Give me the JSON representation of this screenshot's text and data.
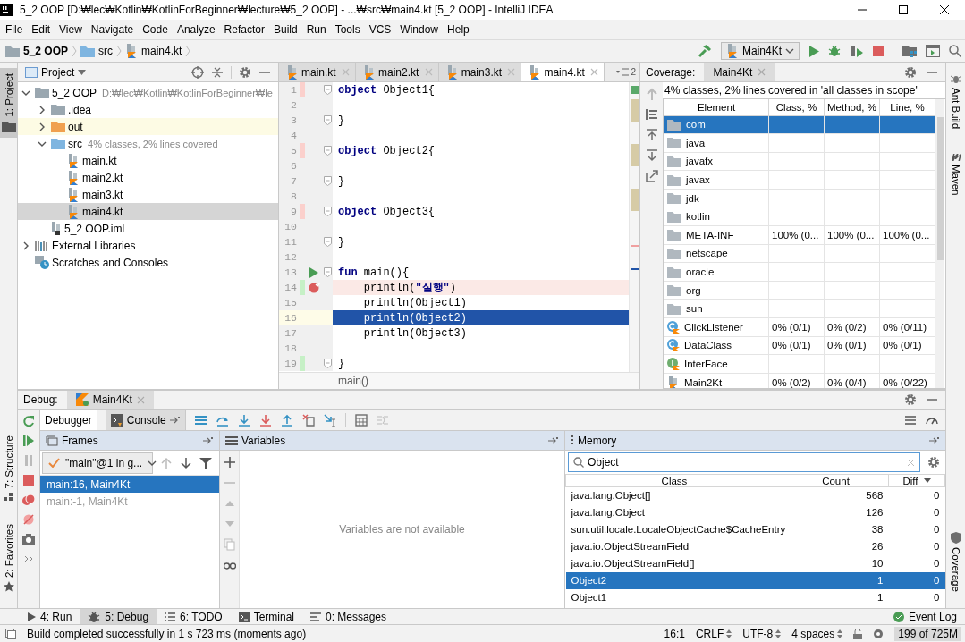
{
  "window": {
    "title": "5_2 OOP [D:₩lec₩Kotlin₩KotlinForBeginner₩lecture₩5_2 OOP] - ...₩src₩main4.kt [5_2 OOP] - IntelliJ IDEA"
  },
  "menu": [
    "File",
    "Edit",
    "View",
    "Navigate",
    "Code",
    "Analyze",
    "Refactor",
    "Build",
    "Run",
    "Tools",
    "VCS",
    "Window",
    "Help"
  ],
  "breadcrumbs": [
    {
      "label": "5_2 OOP",
      "kind": "project"
    },
    {
      "label": "src",
      "kind": "folder"
    },
    {
      "label": "main4.kt",
      "kind": "kotlin"
    }
  ],
  "run_config": {
    "label": "Main4Kt"
  },
  "left_stripe": {
    "top": [
      {
        "label": "1: Project",
        "selected": true
      }
    ],
    "bottom": [
      {
        "label": "7: Structure",
        "selected": false
      },
      {
        "label": "2: Favorites",
        "selected": false
      }
    ]
  },
  "right_stripe": {
    "top": [
      {
        "label": "Ant Build",
        "kind": "ant"
      },
      {
        "label": "Maven",
        "kind": "maven"
      }
    ],
    "bottom": [
      {
        "label": "Coverage",
        "kind": "coverage"
      }
    ]
  },
  "project": {
    "title": "Project",
    "tree": [
      {
        "label": "5_2 OOP",
        "hint": "D:₩lec₩Kotlin₩KotlinForBeginner₩le",
        "kind": "module",
        "expanded": true,
        "selected": false,
        "children": [
          {
            "label": ".idea",
            "kind": "folder",
            "expanded": false,
            "selected": false
          },
          {
            "label": "out",
            "kind": "excluded",
            "expanded": false,
            "selected": false
          },
          {
            "label": "src",
            "hint": "4% classes, 2% lines covered",
            "kind": "source",
            "expanded": true,
            "selected": false,
            "children": [
              {
                "label": "main.kt",
                "kind": "kotlin",
                "selected": false
              },
              {
                "label": "main2.kt",
                "kind": "kotlin",
                "selected": false
              },
              {
                "label": "main3.kt",
                "kind": "kotlin",
                "selected": false
              },
              {
                "label": "main4.kt",
                "kind": "kotlin",
                "selected": true
              }
            ]
          },
          {
            "label": "5_2 OOP.iml",
            "kind": "iml",
            "selected": false
          }
        ]
      },
      {
        "label": "External Libraries",
        "kind": "libraries",
        "expanded": false,
        "selected": false
      },
      {
        "label": "Scratches and Consoles",
        "kind": "scratches",
        "selected": false
      }
    ]
  },
  "editor": {
    "tabs": [
      {
        "label": "main.kt",
        "selected": false
      },
      {
        "label": "main2.kt",
        "selected": false
      },
      {
        "label": "main3.kt",
        "selected": false
      },
      {
        "label": "main4.kt",
        "selected": true
      }
    ],
    "hidden_tabs": "2",
    "lines": [
      {
        "number": "1",
        "code": "**object** Object1{",
        "kind": "plain",
        "fold": true,
        "selected": false,
        "color": "#fbd0cc"
      },
      {
        "number": "2",
        "kind": "plain",
        "fold": false,
        "selected": false
      },
      {
        "number": "3",
        "code": "}",
        "kind": "plain",
        "fold": true,
        "selected": false
      },
      {
        "number": "4",
        "kind": "plain",
        "fold": false,
        "selected": false
      },
      {
        "number": "5",
        "code": "**object** Object2{",
        "kind": "plain",
        "fold": true,
        "selected": false,
        "color": "#fbd0cc"
      },
      {
        "number": "6",
        "kind": "plain",
        "fold": false,
        "selected": false
      },
      {
        "number": "7",
        "code": "}",
        "kind": "plain",
        "fold": true,
        "selected": false
      },
      {
        "number": "8",
        "kind": "plain",
        "fold": false,
        "selected": false
      },
      {
        "number": "9",
        "code": "**object** Object3{",
        "kind": "plain",
        "fold": true,
        "selected": false,
        "color": "#fbd0cc"
      },
      {
        "number": "10",
        "kind": "plain",
        "fold": false,
        "selected": false
      },
      {
        "number": "11",
        "code": "}",
        "kind": "plain",
        "fold": true,
        "selected": false
      },
      {
        "number": "12",
        "kind": "plain",
        "fold": false,
        "selected": false
      },
      {
        "number": "13",
        "code": "**fun** main(){",
        "kind": "run",
        "fold": true,
        "selected": false
      },
      {
        "number": "14",
        "code": "    println(**\"실행\"**)",
        "kind": "breakpoint",
        "fold": false,
        "selected": false,
        "color": "#c6f0c6"
      },
      {
        "number": "15",
        "code": "    println(Object1)",
        "kind": "plain",
        "fold": false,
        "selected": false
      },
      {
        "number": "16",
        "code": "    println(Object2)",
        "kind": "plain",
        "fold": false,
        "selected": true
      },
      {
        "number": "17",
        "code": "    println(Object3)",
        "kind": "plain",
        "fold": false,
        "selected": false
      },
      {
        "number": "18",
        "kind": "plain",
        "fold": false,
        "selected": false
      },
      {
        "number": "19",
        "code": "}",
        "kind": "plain",
        "fold": true,
        "selected": false,
        "color": "#c6f0c6"
      }
    ],
    "breadcrumb": "main()"
  },
  "coverage": {
    "title": "Coverage:",
    "tab": "Main4Kt",
    "summary": "4% classes, 2% lines covered in 'all classes in scope'",
    "columns": [
      "Element",
      "Class, %",
      "Method, %",
      "Line, %"
    ],
    "rows": [
      {
        "element": "com",
        "kind": "package",
        "selected": true
      },
      {
        "element": "java",
        "kind": "package",
        "selected": false
      },
      {
        "element": "javafx",
        "kind": "package",
        "selected": false
      },
      {
        "element": "javax",
        "kind": "package",
        "selected": false
      },
      {
        "element": "jdk",
        "kind": "package",
        "selected": false
      },
      {
        "element": "kotlin",
        "kind": "package",
        "selected": false
      },
      {
        "element": "META-INF",
        "kind": "package",
        "selected": false,
        "class": "100% (0...",
        "method": "100% (0...",
        "line": "100% (0..."
      },
      {
        "element": "netscape",
        "kind": "package",
        "selected": false
      },
      {
        "element": "oracle",
        "kind": "package",
        "selected": false
      },
      {
        "element": "org",
        "kind": "package",
        "selected": false
      },
      {
        "element": "sun",
        "kind": "package",
        "selected": false
      },
      {
        "element": "ClickListener",
        "kind": "class",
        "selected": false,
        "class": "0% (0/1)",
        "method": "0% (0/2)",
        "line": "0% (0/11)"
      },
      {
        "element": "DataClass",
        "kind": "class",
        "selected": false,
        "class": "0% (0/1)",
        "method": "0% (0/1)",
        "line": "0% (0/1)"
      },
      {
        "element": "InterFace",
        "kind": "interface",
        "selected": false
      },
      {
        "element": "Main2Kt",
        "kind": "file",
        "selected": false,
        "class": "0% (0/2)",
        "method": "0% (0/4)",
        "line": "0% (0/22)"
      }
    ]
  },
  "debug": {
    "title": "Debug:",
    "tab": "Main4Kt",
    "subtabs": [
      {
        "label": "Debugger",
        "selected": true
      },
      {
        "label": "Console",
        "selected": false
      }
    ],
    "frames": {
      "title": "Frames",
      "thread": "\"main\"@1 in g...",
      "items": [
        {
          "label": "main:16, Main4Kt",
          "selected": true,
          "disabled": false
        },
        {
          "label": "main:-1, Main4Kt",
          "selected": false,
          "disabled": true
        }
      ]
    },
    "variables": {
      "title": "Variables",
      "empty_text": "Variables are not available"
    },
    "memory": {
      "title": "Memory",
      "search": "Object",
      "columns": [
        "Class",
        "Count",
        "Diff"
      ],
      "rows": [
        {
          "class": "java.lang.Object[]",
          "count": "568",
          "diff": "0",
          "selected": false
        },
        {
          "class": "java.lang.Object",
          "count": "126",
          "diff": "0",
          "selected": false
        },
        {
          "class": "sun.util.locale.LocaleObjectCache$CacheEntry",
          "count": "38",
          "diff": "0",
          "selected": false
        },
        {
          "class": "java.io.ObjectStreamField",
          "count": "26",
          "diff": "0",
          "selected": false
        },
        {
          "class": "java.io.ObjectStreamField[]",
          "count": "10",
          "diff": "0",
          "selected": false
        },
        {
          "class": "Object2",
          "count": "1",
          "diff": "0",
          "selected": true
        },
        {
          "class": "Object1",
          "count": "1",
          "diff": "0",
          "selected": false
        }
      ]
    }
  },
  "tool_tabs": [
    {
      "label": "4: Run",
      "kind": "run",
      "selected": false
    },
    {
      "label": "5: Debug",
      "kind": "debug",
      "selected": true
    },
    {
      "label": "6: TODO",
      "kind": "todo",
      "selected": false
    },
    {
      "label": "Terminal",
      "kind": "terminal",
      "selected": false
    },
    {
      "label": "0: Messages",
      "kind": "messages",
      "selected": false
    }
  ],
  "event_log": "Event Log",
  "status_bar": {
    "message": "Build completed successfully in 1 s 723 ms (moments ago)",
    "position": "16:1",
    "line_separator": "CRLF",
    "encoding": "UTF-8",
    "indent": "4 spaces",
    "memory": "199 of 725M"
  }
}
